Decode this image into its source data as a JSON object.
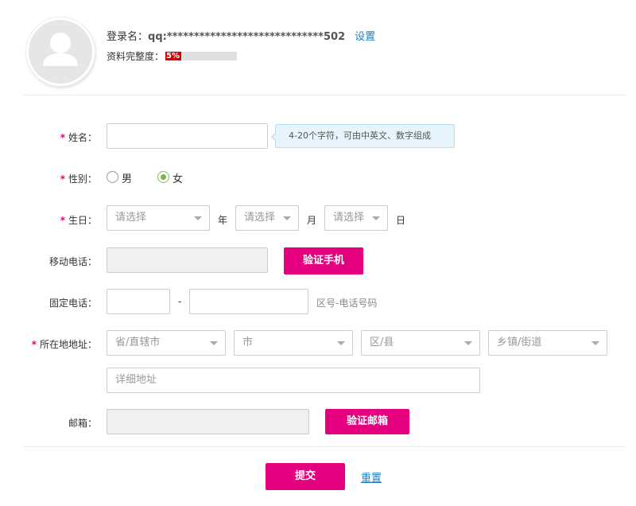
{
  "header": {
    "login_label": "登录名：",
    "login_name": "qq:*****************************502",
    "settings_link": "设置",
    "profile_label": "资料完整度：",
    "profile_percent_text": "5%",
    "profile_percent": 5
  },
  "form": {
    "name": {
      "label": "姓名：",
      "required": "*",
      "value": "",
      "hint": "4-20个字符，可由中英文、数字组成"
    },
    "gender": {
      "label": "性别：",
      "required": "*",
      "male": "男",
      "female": "女",
      "selected": "女"
    },
    "birthday": {
      "label": "生日：",
      "required": "*",
      "year_placeholder": "请选择",
      "year_unit": "年",
      "month_placeholder": "请选择",
      "month_unit": "月",
      "day_placeholder": "请选择",
      "day_unit": "日"
    },
    "mobile": {
      "label": "移动电话：",
      "value": "",
      "verify_button": "验证手机"
    },
    "landline": {
      "label": "固定电话：",
      "separator": "-",
      "hint": "区号-电话号码"
    },
    "address": {
      "label": "所在地地址：",
      "required": "*",
      "province": "省/直辖市",
      "city": "市",
      "district": "区/县",
      "town": "乡镇/街道",
      "detail_placeholder": "详细地址"
    },
    "email": {
      "label": "邮箱：",
      "value": "",
      "verify_button": "验证邮箱"
    }
  },
  "actions": {
    "submit": "提交",
    "reset": "重置"
  },
  "colors": {
    "accent": "#e4007f",
    "link": "#1a7fc1",
    "progress": "#d60000",
    "radio_checked": "#7cb342"
  }
}
